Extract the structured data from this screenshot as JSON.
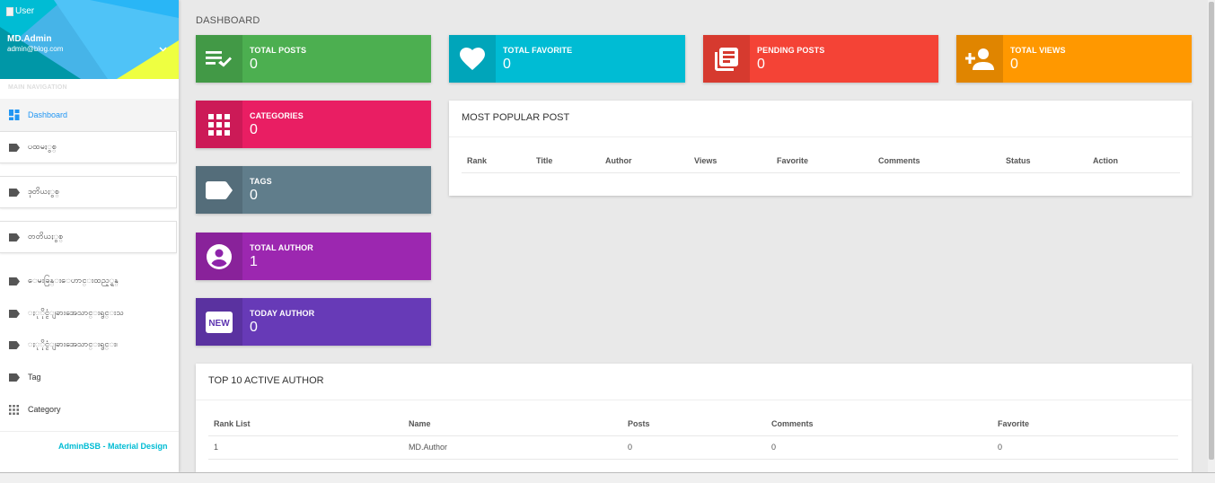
{
  "user": {
    "image_alt": "User",
    "name": "MD.Admin",
    "email": "admin@blog.com"
  },
  "nav": {
    "header": "MAIN NAVIGATION",
    "items": [
      {
        "label": "Dashboard",
        "icon": "dashboard-icon",
        "active": true
      },
      {
        "label": "ပထမႏွစ္",
        "icon": "label-icon"
      },
      {
        "label": "ဒုတိယႏွစ္",
        "icon": "label-icon"
      },
      {
        "label": "တတိယႏွစ္",
        "icon": "label-icon"
      },
      {
        "label": "ေမးခြန္းေဟာင္းထည့္ရန္",
        "icon": "label-icon"
      },
      {
        "label": "ႏုိုင္ငံျခားအေသာင္းရွင္းသ",
        "icon": "label-icon"
      },
      {
        "label": "ႏုိုင္ငံျခားအေသာင္းရွင္း၊",
        "icon": "label-icon"
      },
      {
        "label": "Tag",
        "icon": "label-icon"
      },
      {
        "label": "Category",
        "icon": "apps-icon"
      }
    ],
    "footer": "AdminBSB - Material Design"
  },
  "page": {
    "title": "DASHBOARD"
  },
  "infoboxes": [
    {
      "text": "TOTAL POSTS",
      "number": "0",
      "color": "#4caf50",
      "icon": "playlist-add-check-icon"
    },
    {
      "text": "TOTAL FAVORITE",
      "number": "0",
      "color": "#00bcd4",
      "icon": "favorite-icon"
    },
    {
      "text": "PENDING POSTS",
      "number": "0",
      "color": "#f44336",
      "icon": "library-books-icon"
    },
    {
      "text": "TOTAL VIEWS",
      "number": "0",
      "color": "#ff9800",
      "icon": "person-add-icon"
    },
    {
      "text": "CATEGORIES",
      "number": "0",
      "color": "#e91e63",
      "icon": "apps-icon"
    },
    {
      "text": "TAGS",
      "number": "0",
      "color": "#607d8b",
      "icon": "label-icon"
    },
    {
      "text": "TOTAL AUTHOR",
      "number": "1",
      "color": "#9c27b0",
      "icon": "account-circle-icon"
    },
    {
      "text": "TODAY AUTHOR",
      "number": "0",
      "color": "#673ab7",
      "icon": "fiber-new-icon"
    }
  ],
  "popular_post": {
    "title": "MOST POPULAR POST",
    "columns": [
      "Rank",
      "Title",
      "Author",
      "Views",
      "Favorite",
      "Comments",
      "Status",
      "Action"
    ]
  },
  "top_authors": {
    "title": "TOP 10 ACTIVE AUTHOR",
    "columns": [
      "Rank List",
      "Name",
      "Posts",
      "Comments",
      "Favorite"
    ],
    "rows": [
      [
        "1",
        "MD.Author",
        "0",
        "0",
        "0"
      ]
    ]
  }
}
